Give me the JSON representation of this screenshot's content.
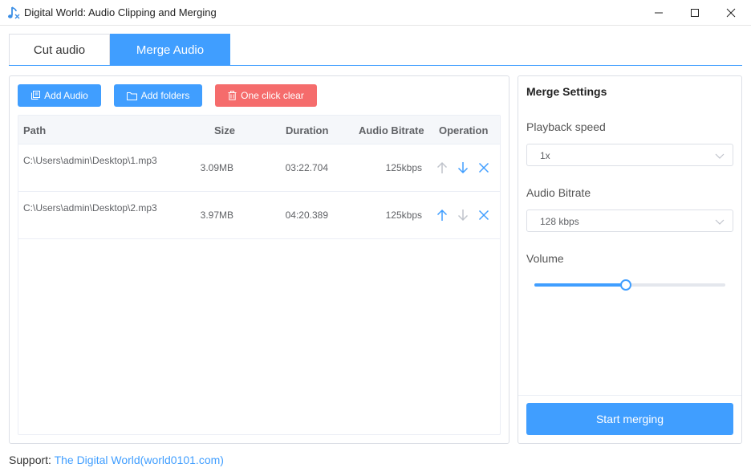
{
  "window": {
    "title": "Digital World: Audio Clipping and Merging",
    "icon": "music-note-icon"
  },
  "tabs": [
    {
      "label": "Cut audio",
      "active": false
    },
    {
      "label": "Merge Audio",
      "active": true
    }
  ],
  "toolbar": {
    "add_audio_label": "Add Audio",
    "add_folders_label": "Add folders",
    "clear_label": "One click clear"
  },
  "table": {
    "headers": {
      "path": "Path",
      "size": "Size",
      "duration": "Duration",
      "bitrate": "Audio Bitrate",
      "operation": "Operation"
    },
    "rows": [
      {
        "path": "C:\\Users\\admin\\Desktop\\1.mp3",
        "size": "3.09MB",
        "duration": "03:22.704",
        "bitrate": "125kbps",
        "can_move_up": false,
        "can_move_down": true
      },
      {
        "path": "C:\\Users\\admin\\Desktop\\2.mp3",
        "size": "3.97MB",
        "duration": "04:20.389",
        "bitrate": "125kbps",
        "can_move_up": true,
        "can_move_down": false
      }
    ]
  },
  "settings": {
    "title": "Merge Settings",
    "playback_speed_label": "Playback speed",
    "playback_speed_value": "1x",
    "bitrate_label": "Audio Bitrate",
    "bitrate_value": "128 kbps",
    "volume_label": "Volume",
    "volume_level": 0.48,
    "start_label": "Start merging"
  },
  "footer": {
    "support_label": "Support: ",
    "support_link": "The Digital World(world0101.com)"
  },
  "colors": {
    "primary": "#409eff",
    "danger": "#f56c6c",
    "disabled_icon": "#c0c4cc"
  }
}
